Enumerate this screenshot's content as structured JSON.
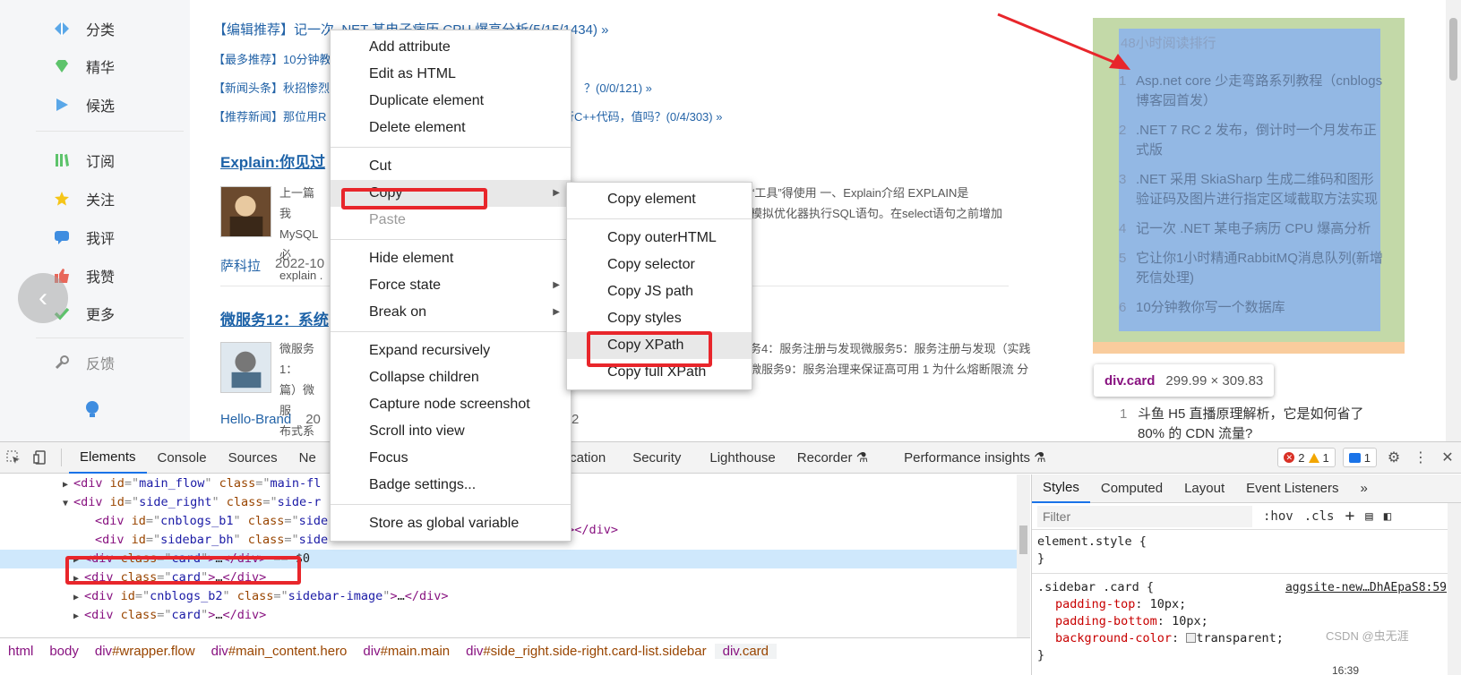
{
  "left_nav": {
    "items": [
      {
        "label": "分类",
        "icon": "diamond-icon",
        "color": "#5aa7e8"
      },
      {
        "label": "精华",
        "icon": "gem-icon",
        "color": "#5dc36b"
      },
      {
        "label": "候选",
        "icon": "play-icon",
        "color": "#5aa7e8"
      },
      {
        "label": "订阅",
        "icon": "books-icon",
        "color": "#5dc36b"
      },
      {
        "label": "关注",
        "icon": "star-icon",
        "color": "#f5c518"
      },
      {
        "label": "我评",
        "icon": "comment-icon",
        "color": "#3f8de0"
      },
      {
        "label": "我赞",
        "icon": "thumbs-up-icon",
        "color": "#e8675a"
      },
      {
        "label": "更多",
        "icon": "check-icon",
        "color": "#5dc36b"
      },
      {
        "label": "反馈",
        "icon": "wrench-icon",
        "color": "#888888"
      }
    ],
    "back_glyph": "‹"
  },
  "main_flow": {
    "headline": "【编辑推荐】记一次 .NET 某电子病历 CPU 爆高分析(5/15/1434) »",
    "news": [
      "【最多推荐】10分钟教",
      "【新闻头条】秋招惨烈",
      "【推荐新闻】那位用R"
    ],
    "news_tails": [
      "？(0/0/121) »",
      "行C++代码，值吗？(0/4/303) »"
    ],
    "posts": [
      {
        "title": "Explain:你见过",
        "text_left": [
          "上一篇我",
          "MySQL必",
          "explain ."
        ],
        "text_right": [
          "相关“工具”得使用 一、Explain介绍 EXPLAIN是",
          "者说模拟优化器执行SQL语句。在select语句之前增加"
        ],
        "author": "萨科拉",
        "date": "2022-10"
      },
      {
        "title": "微服务12：系统",
        "text_left": [
          "微服务1：",
          "篇）微服",
          "布式系统"
        ],
        "text_right": [
          "务4：服务注册与发现微服务5：服务注册与发现（实践",
          "微服务9：服务治理来保证高可用 1 为什么熔断限流 分"
        ],
        "author": "Hello-Brand",
        "date": "20",
        "date_tail": "2"
      }
    ]
  },
  "sidebar_card": {
    "title": "48小时阅读排行",
    "items": [
      {
        "num": "1",
        "text": "Asp.net core 少走弯路系列教程（cnblogs 博客园首发）"
      },
      {
        "num": "2",
        "text": ".NET 7 RC 2 发布，倒计时一个月发布正式版"
      },
      {
        "num": "3",
        "text": ".NET 采用 SkiaSharp 生成二维码和图形验证码及图片进行指定区域截取方法实现"
      },
      {
        "num": "4",
        "text": "记一次 .NET 某电子病历 CPU 爆高分析"
      },
      {
        "num": "5",
        "text": "它让你1小时精通RabbitMQ消息队列(新增死信处理)"
      },
      {
        "num": "6",
        "text": "10分钟教你写一个数据库"
      }
    ],
    "colors": {
      "margin": "#f9cc9d",
      "padding": "#c3d9a8",
      "content": "#93b8e4"
    }
  },
  "tooltip": {
    "selector": "div.card",
    "dims": "299.99 × 309.83"
  },
  "second_list": {
    "num": "1",
    "text": "斗鱼 H5 直播原理解析，它是如何省了80% 的 CDN 流量?"
  },
  "context_menu": {
    "items": [
      {
        "label": "Add attribute"
      },
      {
        "label": "Edit as HTML"
      },
      {
        "label": "Duplicate element"
      },
      {
        "label": "Delete element"
      },
      {
        "sep": true
      },
      {
        "label": "Cut"
      },
      {
        "label": "Copy",
        "submenu": true,
        "highlight": true
      },
      {
        "label": "Paste",
        "disabled": true
      },
      {
        "sep": true
      },
      {
        "label": "Hide element"
      },
      {
        "label": "Force state",
        "submenu": true
      },
      {
        "label": "Break on",
        "submenu": true
      },
      {
        "sep": true
      },
      {
        "label": "Expand recursively"
      },
      {
        "label": "Collapse children"
      },
      {
        "label": "Capture node screenshot"
      },
      {
        "label": "Scroll into view"
      },
      {
        "label": "Focus"
      },
      {
        "label": "Badge settings..."
      },
      {
        "sep": true
      },
      {
        "label": "Store as global variable"
      }
    ]
  },
  "copy_submenu": {
    "items": [
      {
        "label": "Copy element"
      },
      {
        "sep": true
      },
      {
        "label": "Copy outerHTML"
      },
      {
        "label": "Copy selector"
      },
      {
        "label": "Copy JS path"
      },
      {
        "label": "Copy styles"
      },
      {
        "label": "Copy XPath",
        "highlight": true
      },
      {
        "label": "Copy full XPath"
      }
    ]
  },
  "devtools": {
    "tabs": [
      "Elements",
      "Console",
      "Sources",
      "Ne",
      "Application",
      "Security",
      "Lighthouse",
      "Recorder ⚗",
      "Performance insights ⚗"
    ],
    "active_tab": "Elements",
    "errors": "2",
    "warnings": "1",
    "messages": "1",
    "dom_lines": [
      {
        "indent": 5,
        "arrow": "▶",
        "parts": [
          [
            "tag",
            "<div "
          ],
          [
            "attr",
            "id"
          ],
          [
            "eq",
            "=\""
          ],
          [
            "val",
            "main_flow"
          ],
          [
            "eq",
            "\" "
          ],
          [
            "attr",
            "class"
          ],
          [
            "eq",
            "=\""
          ],
          [
            "val",
            "main-fl"
          ]
        ]
      },
      {
        "indent": 5,
        "arrow": "▼",
        "parts": [
          [
            "tag",
            "<div "
          ],
          [
            "attr",
            "id"
          ],
          [
            "eq",
            "=\""
          ],
          [
            "val",
            "side_right"
          ],
          [
            "eq",
            "\" "
          ],
          [
            "attr",
            "class"
          ],
          [
            "eq",
            "=\""
          ],
          [
            "val",
            "side-r"
          ]
        ]
      },
      {
        "indent": 7,
        "arrow": "",
        "parts": [
          [
            "tag",
            "<div "
          ],
          [
            "attr",
            "id"
          ],
          [
            "eq",
            "=\""
          ],
          [
            "val",
            "cnblogs_b1"
          ],
          [
            "eq",
            "\" "
          ],
          [
            "attr",
            "class"
          ],
          [
            "eq",
            "=\""
          ],
          [
            "val",
            "side"
          ]
        ]
      },
      {
        "indent": 7,
        "arrow": "",
        "parts": [
          [
            "tag",
            "<div "
          ],
          [
            "attr",
            "id"
          ],
          [
            "eq",
            "=\""
          ],
          [
            "val",
            "sidebar_bh"
          ],
          [
            "eq",
            "\" "
          ],
          [
            "attr",
            "class"
          ],
          [
            "eq",
            "=\""
          ],
          [
            "val",
            "side"
          ]
        ]
      },
      {
        "indent": 6,
        "arrow": "▶",
        "selected": true,
        "parts": [
          [
            "tag",
            "<div "
          ],
          [
            "attr",
            "class"
          ],
          [
            "eq",
            "=\""
          ],
          [
            "val",
            "card"
          ],
          [
            "eq",
            "\""
          ],
          [
            "tag",
            ">"
          ],
          [
            "txt",
            "…"
          ],
          [
            "tag",
            "</div>"
          ],
          [
            "eq",
            " == "
          ],
          [
            "txt",
            "$0"
          ]
        ]
      },
      {
        "indent": 6,
        "arrow": "▶",
        "parts": [
          [
            "tag",
            "<div "
          ],
          [
            "attr",
            "class"
          ],
          [
            "eq",
            "=\""
          ],
          [
            "val",
            "card"
          ],
          [
            "eq",
            "\""
          ],
          [
            "tag",
            ">"
          ],
          [
            "txt",
            "…"
          ],
          [
            "tag",
            "</div>"
          ]
        ]
      },
      {
        "indent": 6,
        "arrow": "▶",
        "parts": [
          [
            "tag",
            "<div "
          ],
          [
            "attr",
            "id"
          ],
          [
            "eq",
            "=\""
          ],
          [
            "val",
            "cnblogs_b2"
          ],
          [
            "eq",
            "\" "
          ],
          [
            "attr",
            "class"
          ],
          [
            "eq",
            "=\""
          ],
          [
            "val",
            "sidebar-image"
          ],
          [
            "eq",
            "\""
          ],
          [
            "tag",
            ">"
          ],
          [
            "txt",
            "…"
          ],
          [
            "tag",
            "</div>"
          ]
        ]
      },
      {
        "indent": 6,
        "arrow": "▶",
        "parts": [
          [
            "tag",
            "<div "
          ],
          [
            "attr",
            "class"
          ],
          [
            "eq",
            "=\""
          ],
          [
            "val",
            "card"
          ],
          [
            "eq",
            "\""
          ],
          [
            "tag",
            ">"
          ],
          [
            "txt",
            "…"
          ],
          [
            "tag",
            "</div>"
          ]
        ]
      }
    ],
    "dom_tail": "\"></div>",
    "breadcrumbs": [
      {
        "tag": "html",
        "cls": ""
      },
      {
        "tag": "body",
        "cls": ""
      },
      {
        "tag": "div",
        "cls": "#wrapper.flow"
      },
      {
        "tag": "div",
        "cls": "#main_content.hero"
      },
      {
        "tag": "div",
        "cls": "#main.main"
      },
      {
        "tag": "div",
        "cls": "#side_right.side-right.card-list.sidebar"
      },
      {
        "tag": "div",
        "cls": ".card",
        "active": true
      }
    ],
    "styles_tabs": [
      "Styles",
      "Computed",
      "Layout",
      "Event Listeners",
      "»"
    ],
    "filter_placeholder": "Filter",
    "hov": ":hov",
    "cls": ".cls",
    "element_style": "element.style {",
    "close_brace": "}",
    "rule_selector": ".sidebar .card {",
    "rule_source": "aggsite-new…DhAEpaS8:59",
    "props": [
      {
        "name": "padding-top",
        "value": "10px;"
      },
      {
        "name": "padding-bottom",
        "value": "10px;"
      },
      {
        "name": "background-color",
        "value": "transparent;"
      }
    ]
  },
  "watermark": "CSDN @虫无涯",
  "clock": "16:39"
}
